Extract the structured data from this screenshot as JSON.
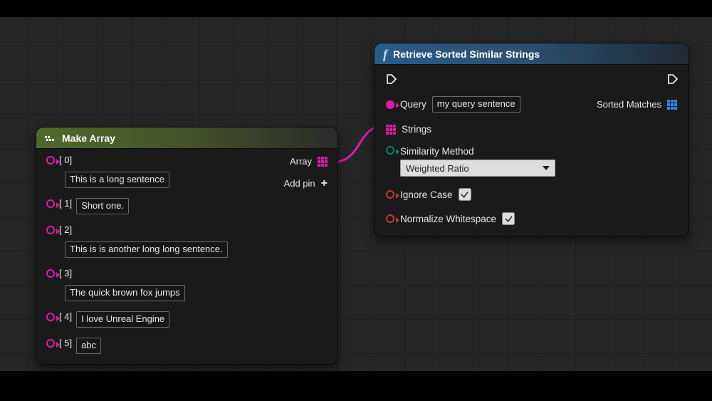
{
  "make_array": {
    "title": "Make Array",
    "out_label": "Array",
    "add_pin_label": "Add pin",
    "entries": [
      {
        "index": "[ 0]",
        "value": "This is a long sentence"
      },
      {
        "index": "[ 1]",
        "value": "Short one."
      },
      {
        "index": "[ 2]",
        "value": "This is is another long long sentence."
      },
      {
        "index": "[ 3]",
        "value": "The quick brown fox jumps"
      },
      {
        "index": "[ 4]",
        "value": "I love Unreal Engine"
      },
      {
        "index": "[ 5]",
        "value": "abc"
      }
    ]
  },
  "retrieve": {
    "title": "Retrieve Sorted Similar Strings",
    "query_label": "Query",
    "query_value": "my query sentence",
    "strings_label": "Strings",
    "similarity_label": "Similarity Method",
    "similarity_value": "Weighted Ratio",
    "ignore_case_label": "Ignore Case",
    "ignore_case_checked": true,
    "normalize_ws_label": "Normalize Whitespace",
    "normalize_ws_checked": true,
    "sorted_matches_label": "Sorted Matches"
  }
}
